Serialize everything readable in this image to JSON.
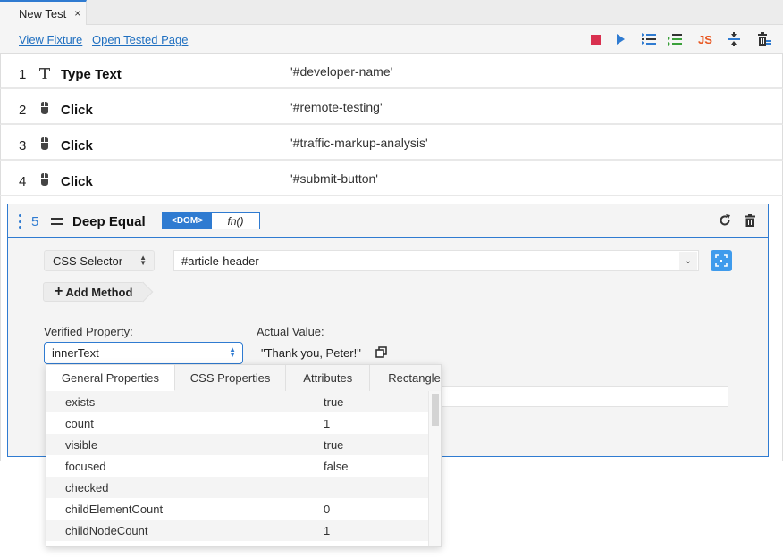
{
  "tab": {
    "title": "New Test",
    "close": "×"
  },
  "toolbar": {
    "view_fixture": "View Fixture",
    "open_tested_page": "Open Tested Page",
    "js_label": "JS",
    "colors": {
      "stop": "#d9304f",
      "run": "#2f7bd1",
      "js": "#e8561f",
      "green": "#3aa03a"
    }
  },
  "steps": [
    {
      "num": "1",
      "icon": "type-text-icon",
      "name": "Type Text",
      "arg": "'#developer-name'"
    },
    {
      "num": "2",
      "icon": "mouse-icon",
      "name": "Click",
      "arg": "'#remote-testing'"
    },
    {
      "num": "3",
      "icon": "mouse-icon",
      "name": "Click",
      "arg": "'#traffic-markup-analysis'"
    },
    {
      "num": "4",
      "icon": "mouse-icon",
      "name": "Click",
      "arg": "'#submit-button'"
    }
  ],
  "active_step": {
    "num": "5",
    "name": "Deep Equal",
    "mode_dom": "<DOM>",
    "mode_fn": "fn()",
    "selector_type": "CSS Selector",
    "selector_value": "#article-header",
    "add_method": "Add Method",
    "verified_property_label": "Verified Property:",
    "verified_property_value": "innerText",
    "actual_value_label": "Actual Value:",
    "actual_value": "\"Thank you, Peter!\"",
    "expected_value": ""
  },
  "dropdown": {
    "tabs": [
      "General Properties",
      "CSS Properties",
      "Attributes",
      "Rectangle"
    ],
    "active_tab": "General Properties",
    "rows": [
      {
        "key": "exists",
        "value": "true"
      },
      {
        "key": "count",
        "value": "1"
      },
      {
        "key": "visible",
        "value": "true"
      },
      {
        "key": "focused",
        "value": "false"
      },
      {
        "key": "checked",
        "value": ""
      },
      {
        "key": "childElementCount",
        "value": "0"
      },
      {
        "key": "childNodeCount",
        "value": "1"
      },
      {
        "key": "",
        "value": ""
      }
    ]
  }
}
